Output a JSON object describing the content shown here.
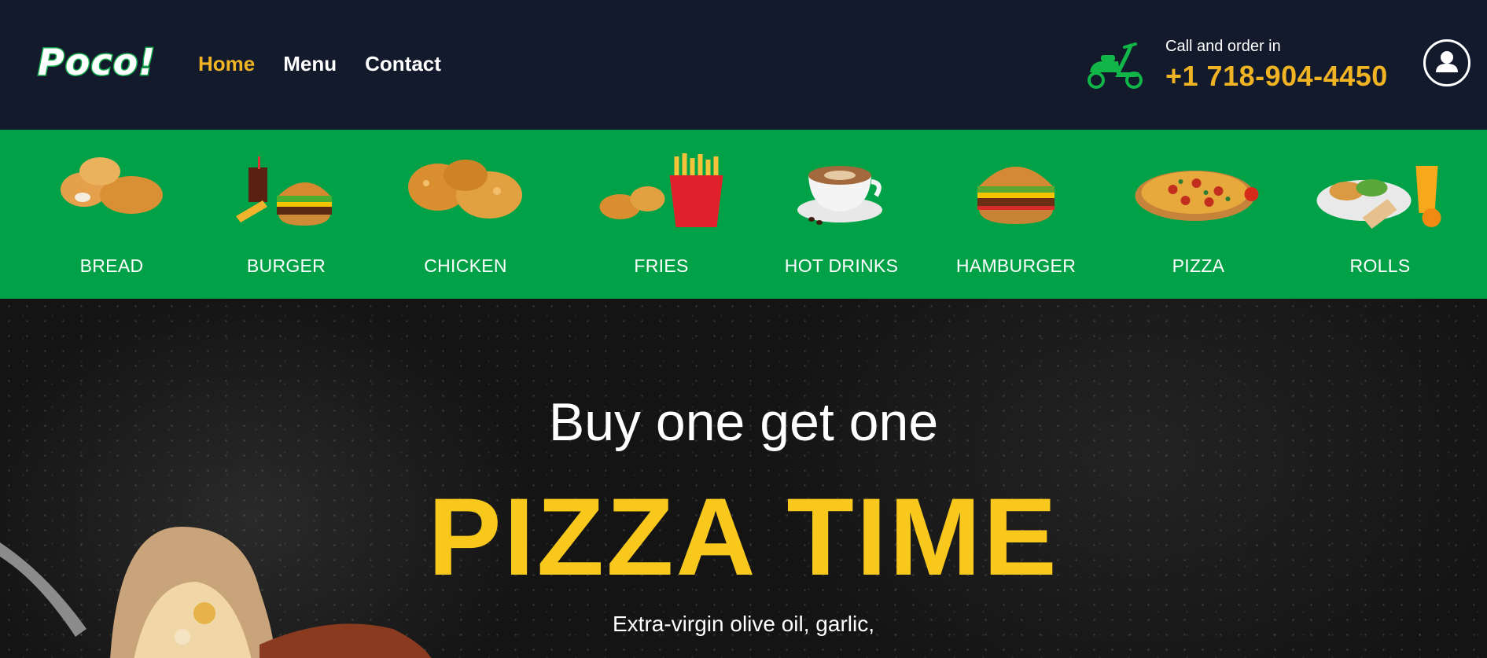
{
  "header": {
    "logo": "Poco!",
    "nav": [
      {
        "label": "Home",
        "active": true
      },
      {
        "label": "Menu",
        "active": false
      },
      {
        "label": "Contact",
        "active": false
      }
    ],
    "call_label": "Call and order in",
    "phone": "+1 718-904-4450",
    "scooter_icon": "scooter-icon",
    "user_icon": "user-icon"
  },
  "categories": [
    {
      "label": "BREAD",
      "icon": "nuggets-icon"
    },
    {
      "label": "BURGER",
      "icon": "burger-combo-icon"
    },
    {
      "label": "CHICKEN",
      "icon": "fried-chicken-icon"
    },
    {
      "label": "FRIES",
      "icon": "fries-icon"
    },
    {
      "label": "HOT DRINKS",
      "icon": "coffee-cup-icon"
    },
    {
      "label": "HAMBURGER",
      "icon": "hamburger-icon"
    },
    {
      "label": "PIZZA",
      "icon": "pizza-icon"
    },
    {
      "label": "ROLLS",
      "icon": "rolls-icon"
    }
  ],
  "hero": {
    "subtitle": "Buy one get one",
    "title": "PIZZA TIME",
    "description": "Extra-virgin olive oil, garlic,"
  },
  "colors": {
    "header_bg": "#121a2c",
    "accent": "#f0b323",
    "green": "#01a247",
    "hero_title": "#f8c81c"
  }
}
